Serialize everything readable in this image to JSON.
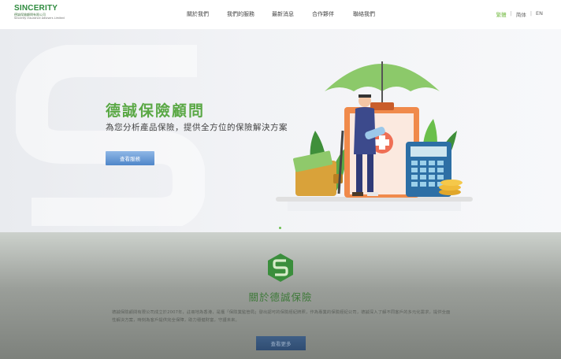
{
  "brand": {
    "name": "SINCERITY",
    "tagline_cn": "德誠保險顧問有限公司",
    "tagline_en": "Sincerity Insurance Advisers Limited",
    "accent_color": "#5aa845"
  },
  "nav": {
    "items": [
      {
        "label": "關於我們"
      },
      {
        "label": "我們的服務"
      },
      {
        "label": "最新消息"
      },
      {
        "label": "合作夥伴"
      },
      {
        "label": "聯絡我們"
      }
    ]
  },
  "language": {
    "options": [
      "繁體",
      "简体",
      "EN"
    ],
    "selected": "繁體"
  },
  "hero": {
    "title": "德誠保險顧問",
    "subtitle": "為您分析產品保險，提供全方位的保險解決方案",
    "button_label": "查看服務"
  },
  "about": {
    "title": "關於德誠保險",
    "body": "德誠保險顧問有限公司成立於2007年，註冊地為香港，是獲「保險業監管局」發出認可的保險經紀牌照，作為專業的保險經紀公司，德誠深入了解不同客戶的多元化需求，提供全面性解決方案，時刻為客戶提供完全保障，助力穩健財富，守護未來。",
    "button_label": "查看更多"
  }
}
